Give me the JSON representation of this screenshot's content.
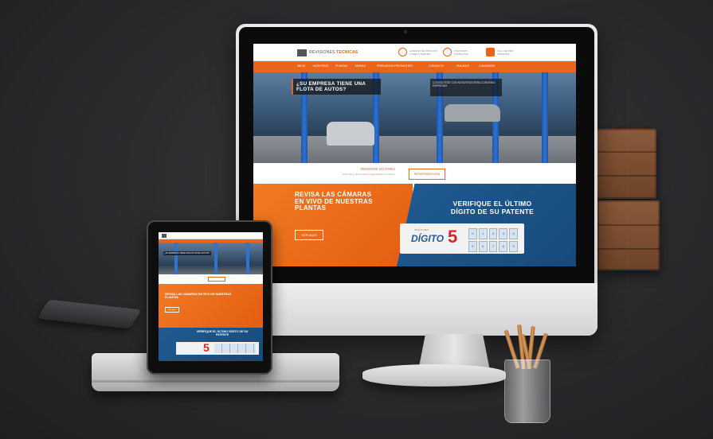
{
  "scene": {
    "background": "#2c2c2f",
    "accent_orange": "#e8651a",
    "accent_blue": "#1f5b92"
  },
  "site": {
    "logo_text_1": "REVISIONES",
    "logo_text_2": "TECNICAS",
    "contact_1_line_1": "HORARIO DE ATENCIÓN",
    "contact_1_line_2": "LUNES A VIERNES",
    "contact_2_line_1": "WHATSAPP",
    "contact_2_line_2": "CONSULTAS",
    "contact_3_line_1": "CALL CENTER",
    "contact_3_line_2": "ATENCIÓN",
    "nav": [
      "INICIO",
      "NOSOTROS",
      "PLANTAS",
      "TARIFAS",
      "PREGUNTAS FRECUENTES",
      "CONTACTO",
      "ENLACES",
      "CONVENIOS"
    ],
    "hero_caption_main": "¿SU EMPRESA TIENE UNA FLOTA DE AUTOS?",
    "hero_caption_side": "CONTÁCTESE CON NOSOTROS PARA CONVENIO EMPRESAS",
    "cta_label": "RESERVE SU HORA",
    "cta_sub": "Evite filas y ahorre tiempo agendando su revisión",
    "cta_button": "RESERVAR HORA",
    "orange_title": "REVISA LAS CÁMARAS EN VIVO DE NUESTRAS PLANTAS",
    "orange_button": "VER AQUÍ",
    "blue_title": "VERIFIQUE EL ÚLTIMO DÍGITO DE SU PATENTE",
    "plate_label": "SEGÚN MES",
    "plate_word": "DÍGITO",
    "plate_number": "5",
    "plate_grid": [
      "0",
      "1",
      "2",
      "3",
      "4",
      "5",
      "6",
      "7",
      "8",
      "9"
    ]
  },
  "ipad": {
    "hero_caption": "¿SU EMPRESA TIENE UNA FLOTA DE AUTOS?",
    "orange_title": "REVISA LAS CÁMARAS EN VIVO DE NUESTRAS PLANTAS",
    "orange_button": "VER AQUÍ",
    "blue_title": "VERIFIQUE EL ÚLTIMO DÍGITO DE SU PATENTE",
    "plate_number": "5"
  }
}
